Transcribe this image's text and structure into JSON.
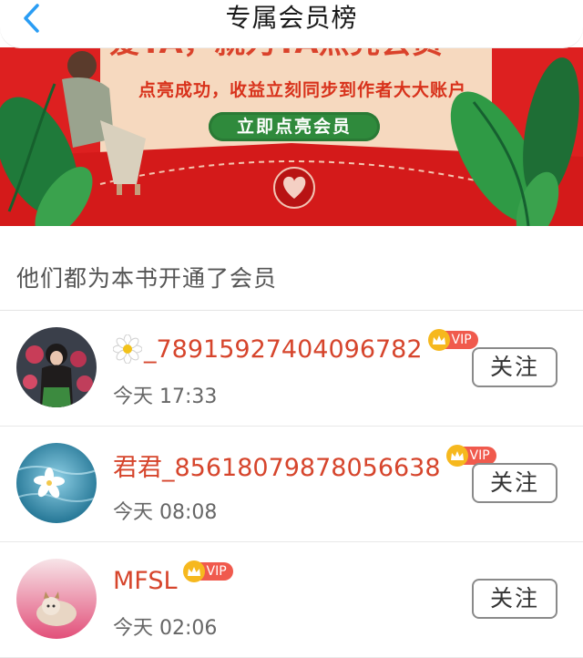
{
  "header": {
    "title": "专属会员榜",
    "back_icon": "chevron-left-icon",
    "accent_color": "#2a9df4"
  },
  "banner": {
    "subtitle": "点亮成功，收益立刻同步到作者大大账户",
    "button_label": "立即点亮会员",
    "background_color": "#dd2020"
  },
  "section": {
    "title": "他们都为本书开通了会员"
  },
  "members": [
    {
      "name": "_78915927404096782",
      "name_prefix_icon": "flower-icon",
      "vip_label": "VIP",
      "time": "今天 17:33",
      "follow_label": "关注"
    },
    {
      "name": "君君_85618079878056638",
      "name_prefix_icon": "",
      "vip_label": "VIP",
      "time": "今天 08:08",
      "follow_label": "关注"
    },
    {
      "name": "MFSL",
      "name_prefix_icon": "",
      "vip_label": "VIP",
      "time": "今天 02:06",
      "follow_label": "关注"
    }
  ],
  "colors": {
    "name": "#d6452c",
    "vip_tag": "#f05a4d",
    "vip_crown": "#f6b81e"
  }
}
